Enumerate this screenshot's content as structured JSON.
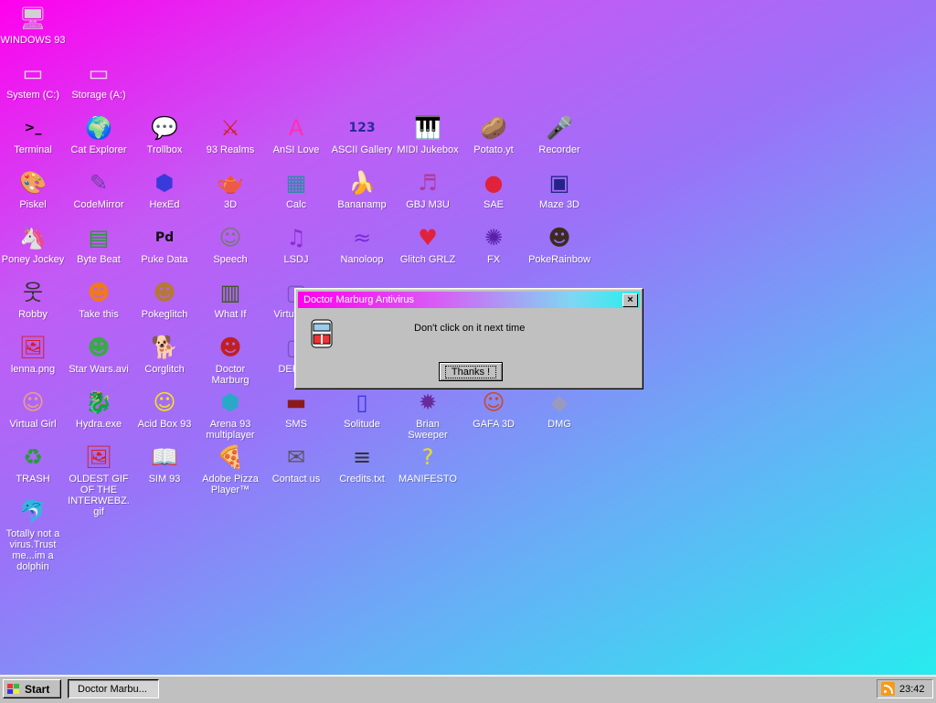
{
  "desktop": {
    "icons": [
      {
        "label": "WINDOWS 93",
        "glyph": "🖥",
        "color": "#d0d0d0"
      },
      {
        "label": "System (C:)",
        "glyph": "▭",
        "color": "#e0e0e0"
      },
      {
        "label": "Storage (A:)",
        "glyph": "▭",
        "color": "#e0e0e0"
      },
      {
        "label": "Terminal",
        "glyph": ">_",
        "color": "#000000"
      },
      {
        "label": "Cat Explorer",
        "glyph": "🌍",
        "color": "#2b7bd0"
      },
      {
        "label": "Trollbox",
        "glyph": "💬",
        "color": "#35c4ff"
      },
      {
        "label": "93 Realms",
        "glyph": "⚔",
        "color": "#d01f1f"
      },
      {
        "label": "AnSI Love",
        "glyph": "A",
        "color": "#ff2fb0"
      },
      {
        "label": "ASCII Gallery",
        "glyph": "123",
        "color": "#2a2a9a"
      },
      {
        "label": "MIDI Jukebox",
        "glyph": "🎹",
        "color": "#000000"
      },
      {
        "label": "Potato.yt",
        "glyph": "🥔",
        "color": "#b67933"
      },
      {
        "label": "Recorder",
        "glyph": "🎤",
        "color": "#555555"
      },
      {
        "label": "Piskel",
        "glyph": "🎨",
        "color": "#e7b344"
      },
      {
        "label": "CodeMirror",
        "glyph": "✎",
        "color": "#6b3fa0"
      },
      {
        "label": "HexEd",
        "glyph": "⬢",
        "color": "#3a3adb"
      },
      {
        "label": "3D",
        "glyph": "🫖",
        "color": "#f0a0c0"
      },
      {
        "label": "Calc",
        "glyph": "▦",
        "color": "#2d8aa8"
      },
      {
        "label": "Bananamp",
        "glyph": "🍌",
        "color": "#f1d21c"
      },
      {
        "label": "GBJ M3U",
        "glyph": "♬",
        "color": "#b03a9a"
      },
      {
        "label": "SAE",
        "glyph": "●",
        "color": "#e0223a"
      },
      {
        "label": "Maze 3D",
        "glyph": "▣",
        "color": "#242488"
      },
      {
        "label": "Poney Jockey",
        "glyph": "🦄",
        "color": "#9e5bd3"
      },
      {
        "label": "Byte Beat",
        "glyph": "▤",
        "color": "#1aa12a"
      },
      {
        "label": "Puke Data",
        "glyph": "Pd",
        "color": "#111111"
      },
      {
        "label": "Speech",
        "glyph": "☺",
        "color": "#777777"
      },
      {
        "label": "LSDJ",
        "glyph": "♫",
        "color": "#8f2bd8"
      },
      {
        "label": "Nanoloop",
        "glyph": "≈",
        "color": "#7a2bd8"
      },
      {
        "label": "Glitch GRLZ",
        "glyph": "♥",
        "color": "#e0233a"
      },
      {
        "label": "FX",
        "glyph": "✺",
        "color": "#5a20a8"
      },
      {
        "label": "PokeRainbow",
        "glyph": "☻",
        "color": "#3d2b1f"
      },
      {
        "label": "Robby",
        "glyph": "웃",
        "color": "#333333"
      },
      {
        "label": "Take this",
        "glyph": "☻",
        "color": "#f07a1a"
      },
      {
        "label": "Pokeglitch",
        "glyph": "☻",
        "color": "#b67933"
      },
      {
        "label": "What If",
        "glyph": "▥",
        "color": "#3d5c1f"
      },
      {
        "label": "Virtual PC",
        "glyph": "▢",
        "color": "#7a55c0"
      },
      {
        "label": "lenna.png",
        "glyph": "🖼",
        "color": "#d42020"
      },
      {
        "label": "Star Wars.avi",
        "glyph": "☻",
        "color": "#3aa84a"
      },
      {
        "label": "Corglitch",
        "glyph": "🐕",
        "color": "#d4862b"
      },
      {
        "label": "Doctor Marburg",
        "glyph": "☻",
        "color": "#c02020"
      },
      {
        "label": "DERGS",
        "glyph": "▢",
        "color": "#7a55c0"
      },
      {
        "label": "Virtual Girl",
        "glyph": "☺",
        "color": "#e8a088"
      },
      {
        "label": "Hydra.exe",
        "glyph": "🐉",
        "color": "#2a8a3a"
      },
      {
        "label": "Acid Box 93",
        "glyph": "☺",
        "color": "#f5e21c"
      },
      {
        "label": "Arena 93 multiplayer",
        "glyph": "⬢",
        "color": "#2aa8c8"
      },
      {
        "label": "SMS",
        "glyph": "▬",
        "color": "#8a1a1a"
      },
      {
        "label": "Solitude",
        "glyph": "▯",
        "color": "#3a3adb"
      },
      {
        "label": "Brian Sweeper",
        "glyph": "✹",
        "color": "#6a2a9a"
      },
      {
        "label": "GAFA 3D",
        "glyph": "☺",
        "color": "#c84a2a"
      },
      {
        "label": "DMG",
        "glyph": "◆",
        "color": "#9a9ac0"
      },
      {
        "label": "TRASH",
        "glyph": "♻",
        "color": "#2a9a3a"
      },
      {
        "label": "OLDEST GIF OF THE INTERWEBZ.gif",
        "glyph": "🖼",
        "color": "#d42020"
      },
      {
        "label": "SIM 93",
        "glyph": "📖",
        "color": "#555555"
      },
      {
        "label": "Adobe Pizza Player™",
        "glyph": "🍕",
        "color": "#e3a830"
      },
      {
        "label": "Contact us",
        "glyph": "✉",
        "color": "#555555"
      },
      {
        "label": "Credits.txt",
        "glyph": "≡",
        "color": "#333333"
      },
      {
        "label": "MANIFESTO",
        "glyph": "?",
        "color": "#e8e01c"
      },
      {
        "label": "Totally not a virus.Trust me...im a dolphin",
        "glyph": "🐬",
        "color": "#3aa8c8"
      }
    ]
  },
  "dialog": {
    "title": "Doctor Marburg Antivirus",
    "close_glyph": "×",
    "message": "Don't click on it next time",
    "button_label": "Thanks !"
  },
  "taskbar": {
    "start_label": "Start",
    "task_label": "Doctor Marbu...",
    "clock": "23:42"
  }
}
